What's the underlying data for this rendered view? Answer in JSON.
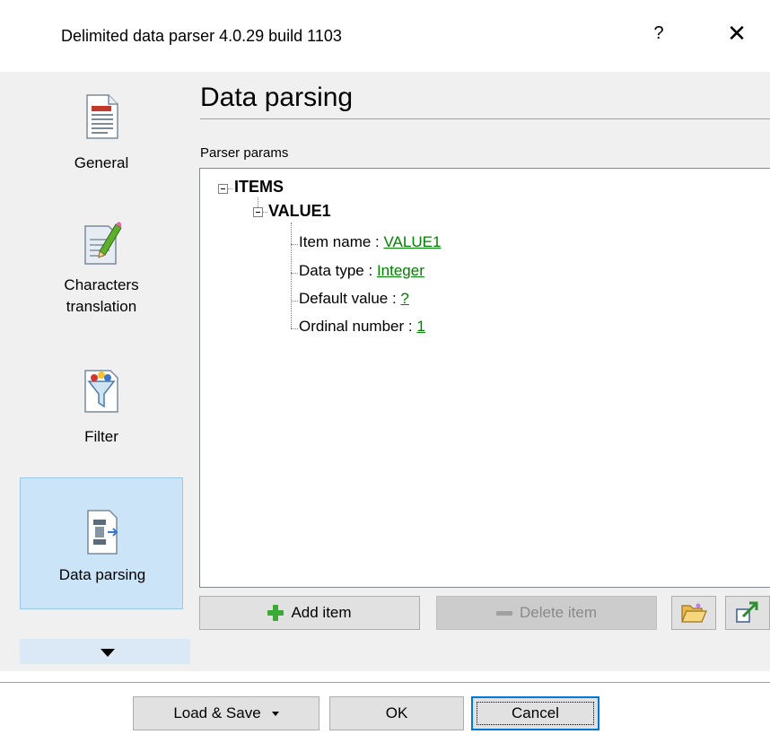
{
  "window": {
    "title": "Delimited data parser 4.0.29 build 1103",
    "help_glyph": "?",
    "close_glyph": "✕"
  },
  "nav": {
    "items": [
      {
        "label": "General",
        "icon": "document-icon"
      },
      {
        "label_line1": "Characters",
        "label_line2": "translation",
        "icon": "edit-pencil-icon"
      },
      {
        "label": "Filter",
        "icon": "filter-funnel-icon"
      },
      {
        "label": "Data parsing",
        "icon": "data-parsing-icon",
        "selected": true
      }
    ],
    "scroll_icon": "chevron-down-icon"
  },
  "page": {
    "title": "Data parsing",
    "group_label": "Parser params"
  },
  "tree": {
    "root": "ITEMS",
    "child": "VALUE1",
    "fields": [
      {
        "label": "Item name : ",
        "value": "VALUE1"
      },
      {
        "label": "Data type : ",
        "value": "Integer"
      },
      {
        "label": "Default value : ",
        "value": "?"
      },
      {
        "label": "Ordinal number : ",
        "value": "1"
      }
    ]
  },
  "toolbar": {
    "add_label": "Add item",
    "delete_label": "Delete item",
    "open_icon": "folder-open-icon",
    "export_icon": "export-icon"
  },
  "footer": {
    "load_save_label": "Load & Save",
    "ok_label": "OK",
    "cancel_label": "Cancel"
  },
  "colors": {
    "accent": "#0078d7",
    "selected_bg": "#cce4f7",
    "value_link": "#008000",
    "add_green": "#3aa935"
  }
}
